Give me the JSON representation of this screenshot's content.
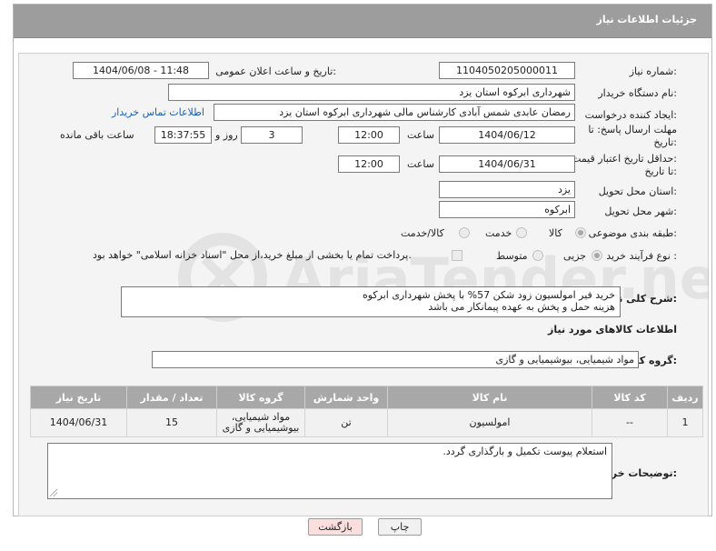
{
  "header": {
    "title": "جزئیات اطلاعات نیاز"
  },
  "form": {
    "need_number_label": "شماره نیاز:",
    "need_number": "1104050205000011",
    "announce_label": "تاریخ و ساعت اعلان عمومی:",
    "announce_value": "1404/06/08 - 11:48",
    "buyer_org_label": "نام دستگاه خریدار:",
    "buyer_org": "شهرداری ابرکوه استان یزد",
    "requester_label": "ایجاد کننده درخواست:",
    "requester": "رمضان عابدی شمس آبادی کارشناس مالی شهرداری ابرکوه استان یزد",
    "contact_link": "اطلاعات تماس خریدار",
    "deadline_label_1": "مهلت ارسال پاسخ: تا",
    "deadline_label_2": "تاریخ:",
    "deadline_date": "1404/06/12",
    "time_label": "ساعت",
    "deadline_time": "12:00",
    "days_value": "3",
    "days_label": "روز و",
    "remaining_time": "18:37:55",
    "remaining_label": "ساعت باقی مانده",
    "price_validity_label_1": "حداقل تاریخ اعتبار قیمت:",
    "price_validity_label_2": "تا تاریخ:",
    "price_validity_date": "1404/06/31",
    "price_validity_time": "12:00",
    "province_label": "استان محل تحویل:",
    "province": "یزد",
    "city_label": "شهر محل تحویل:",
    "city": "ابرکوه",
    "category_label": "طبقه بندی موضوعی:",
    "category_options": [
      "کالا",
      "خدمت",
      "کالا/خدمت"
    ],
    "category_selected": "کالا",
    "process_label": "نوع فرآیند خرید :",
    "process_options": [
      "جزیی",
      "متوسط"
    ],
    "process_selected": "جزیی",
    "payment_note": "پرداخت تمام یا بخشی از مبلغ خرید،از محل \"اسناد خزانه اسلامی\" خواهد بود.",
    "general_desc_label": "شرح کلی نیاز:",
    "general_desc": "خرید فیر امولسیون زود شکن 57% با پخش شهرداری ابرکوه\nهزینه حمل و پخش به عهده پیمانکار می باشد"
  },
  "goods": {
    "section_title": "اطلاعات کالاهای مورد نیاز",
    "group_label": "گروه کالا:",
    "group_value": "مواد شیمیایی، بیوشیمیایی و  گازی",
    "columns": [
      "ردیف",
      "کد کالا",
      "نام کالا",
      "واحد شمارش",
      "گروه کالا",
      "تعداد / مقدار",
      "تاریخ نیاز"
    ],
    "rows": [
      {
        "index": "1",
        "code": "--",
        "name": "امولسیون",
        "unit": "تن",
        "group": "مواد شیمیایی، بیوشیمیایی و گازی",
        "qty": "15",
        "date": "1404/06/31"
      }
    ]
  },
  "buyer_notes": {
    "label": "توضیحات خریدار:",
    "text": "استعلام پیوست تکمیل و بارگذاری گردد."
  },
  "buttons": {
    "print": "چاپ",
    "back": "بازگشت"
  },
  "watermark": {
    "brand": "AriaTender.net"
  },
  "colors": {
    "titlebar": "#9d9d9d",
    "table_header": "#a8a8a8",
    "link": "#1a5fb4",
    "back_button": "#fbdede"
  }
}
